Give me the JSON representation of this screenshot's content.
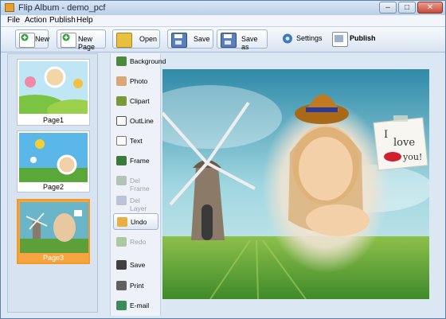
{
  "window": {
    "title": "Flip Album - demo_pcf",
    "minimize": "–",
    "maximize": "□",
    "close": "✕"
  },
  "menu": [
    "File",
    "Action",
    "Publish",
    "Help"
  ],
  "toolbar": {
    "new": "New",
    "new_page": "New Page",
    "open": "Open",
    "save": "Save",
    "save_as": "Save as",
    "settings": "Settings",
    "publish": "Publish"
  },
  "pages": [
    {
      "label": "Page1"
    },
    {
      "label": "Page2"
    },
    {
      "label": "Page3",
      "selected": true
    }
  ],
  "tools": [
    {
      "label": "Background",
      "icon": "background-icon",
      "enabled": true
    },
    {
      "label": "Photo",
      "icon": "photo-icon",
      "enabled": true
    },
    {
      "label": "Clipart",
      "icon": "clipart-icon",
      "enabled": true
    },
    {
      "label": "OutLine",
      "icon": "outline-icon",
      "enabled": true
    },
    {
      "label": "Text",
      "icon": "text-icon",
      "enabled": true
    },
    {
      "label": "Frame",
      "icon": "frame-icon",
      "enabled": true
    },
    {
      "label": "Del Frame",
      "icon": "delete-frame-icon",
      "enabled": false
    },
    {
      "label": "Del Layer",
      "icon": "delete-layer-icon",
      "enabled": false
    },
    {
      "label": "Undo",
      "icon": "undo-icon",
      "enabled": true,
      "active": true
    },
    {
      "label": "Redo",
      "icon": "redo-icon",
      "enabled": false
    },
    {
      "label": "Save",
      "icon": "save-icon",
      "enabled": true
    },
    {
      "label": "Print",
      "icon": "print-icon",
      "enabled": true
    },
    {
      "label": "E-mail",
      "icon": "email-icon",
      "enabled": true
    }
  ],
  "canvas": {
    "note_text_line1": "I",
    "note_text_line2": "love",
    "note_text_line3": "you!"
  },
  "colors": {
    "accent": "#f39c20",
    "window_chrome": "#dce7f4",
    "close_button": "#c8493a"
  }
}
